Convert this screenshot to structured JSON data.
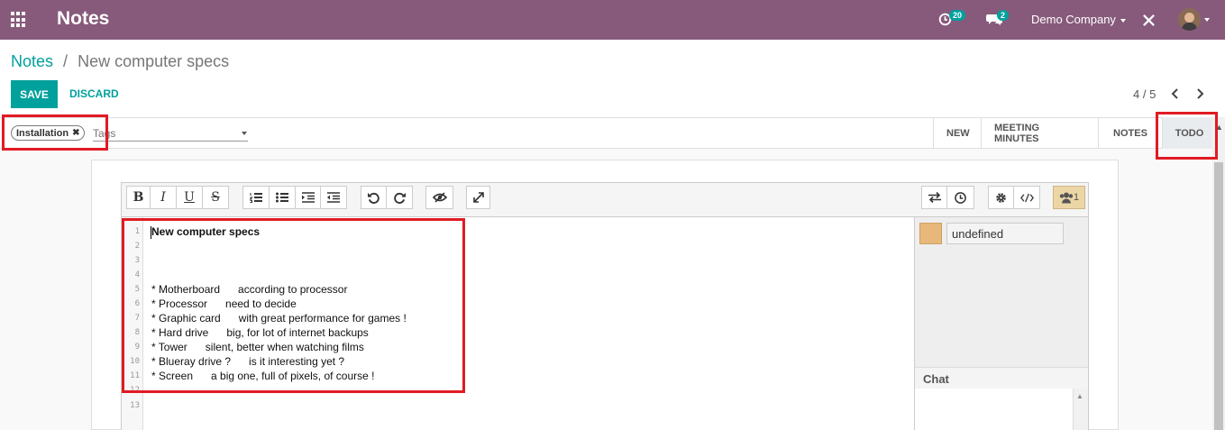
{
  "app": {
    "title": "Notes"
  },
  "systray": {
    "activity_count": "20",
    "message_count": "2",
    "company": "Demo Company"
  },
  "breadcrumb": {
    "parent": "Notes",
    "separator": "/",
    "current": "New computer specs"
  },
  "control": {
    "save_label": "SAVE",
    "discard_label": "DISCARD",
    "pager": "4 / 5"
  },
  "tags": {
    "selected": "Installation",
    "placeholder": "Tags"
  },
  "stages": [
    {
      "label": "NEW",
      "active": false
    },
    {
      "label": "MEETING MINUTES",
      "active": false
    },
    {
      "label": "NOTES",
      "active": false
    },
    {
      "label": "TODO",
      "active": true
    }
  ],
  "editor": {
    "lines": [
      "New computer specs",
      "",
      "",
      "",
      "* Motherboard      according to processor",
      "* Processor      need to decide",
      "* Graphic card      with great performance for games !",
      "* Hard drive      big, for lot of internet backups",
      "* Tower      silent, better when watching films",
      "* Blueray drive ?      is it interesting yet ?",
      "* Screen      a big one, full of pixels, of course !"
    ],
    "line_numbers": [
      "1",
      "2",
      "3",
      "4",
      "5",
      "6",
      "7",
      "8",
      "9",
      "10",
      "11",
      "12",
      "13"
    ]
  },
  "collab": {
    "author_name": "undefined",
    "users_count": "1",
    "chat_label": "Chat"
  },
  "colors": {
    "brand": "#875a7b",
    "accent": "#00a09d",
    "highlight": "#e01b24"
  }
}
